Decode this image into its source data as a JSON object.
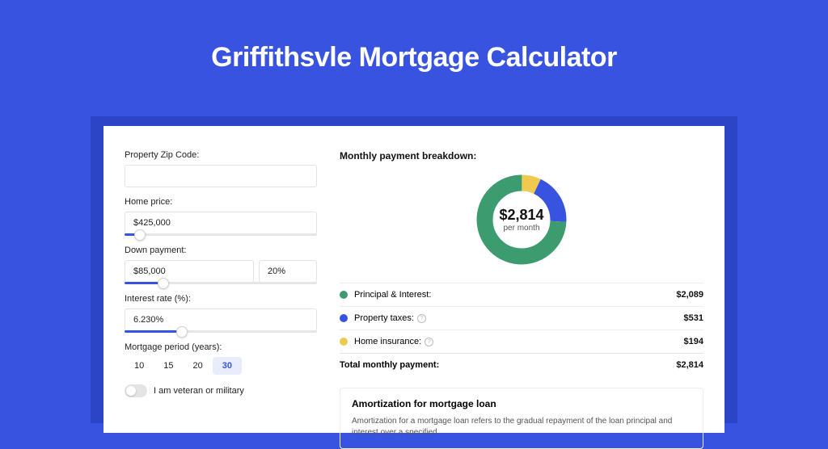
{
  "title": "Griffithsvle Mortgage Calculator",
  "form": {
    "zip": {
      "label": "Property Zip Code:",
      "value": ""
    },
    "home_price": {
      "label": "Home price:",
      "value": "$425,000",
      "slider_pct": 8
    },
    "down_payment": {
      "label": "Down payment:",
      "value": "$85,000",
      "pct": "20%",
      "slider_pct": 20
    },
    "interest": {
      "label": "Interest rate (%):",
      "value": "6.230%",
      "slider_pct": 30
    },
    "period": {
      "label": "Mortgage period (years):",
      "options": [
        "10",
        "15",
        "20",
        "30"
      ],
      "active": "30"
    },
    "veteran": {
      "label": "I am veteran or military",
      "on": false
    }
  },
  "breakdown": {
    "title": "Monthly payment breakdown:",
    "center_amount": "$2,814",
    "center_sub": "per month",
    "items": [
      {
        "label": "Principal & Interest:",
        "amount": "$2,089",
        "color": "#3d9b70",
        "info": false
      },
      {
        "label": "Property taxes:",
        "amount": "$531",
        "color": "#3853e0",
        "info": true
      },
      {
        "label": "Home insurance:",
        "amount": "$194",
        "color": "#f0c94f",
        "info": true
      }
    ],
    "total": {
      "label": "Total monthly payment:",
      "amount": "$2,814"
    }
  },
  "chart_data": {
    "type": "pie",
    "title": "Monthly payment breakdown",
    "series": [
      {
        "name": "Principal & Interest",
        "value": 2089,
        "color": "#3d9b70"
      },
      {
        "name": "Property taxes",
        "value": 531,
        "color": "#3853e0"
      },
      {
        "name": "Home insurance",
        "value": 194,
        "color": "#f0c94f"
      }
    ],
    "total": 2814,
    "center_label": "$2,814 per month"
  },
  "amort": {
    "title": "Amortization for mortgage loan",
    "text": "Amortization for a mortgage loan refers to the gradual repayment of the loan principal and interest over a specified"
  }
}
